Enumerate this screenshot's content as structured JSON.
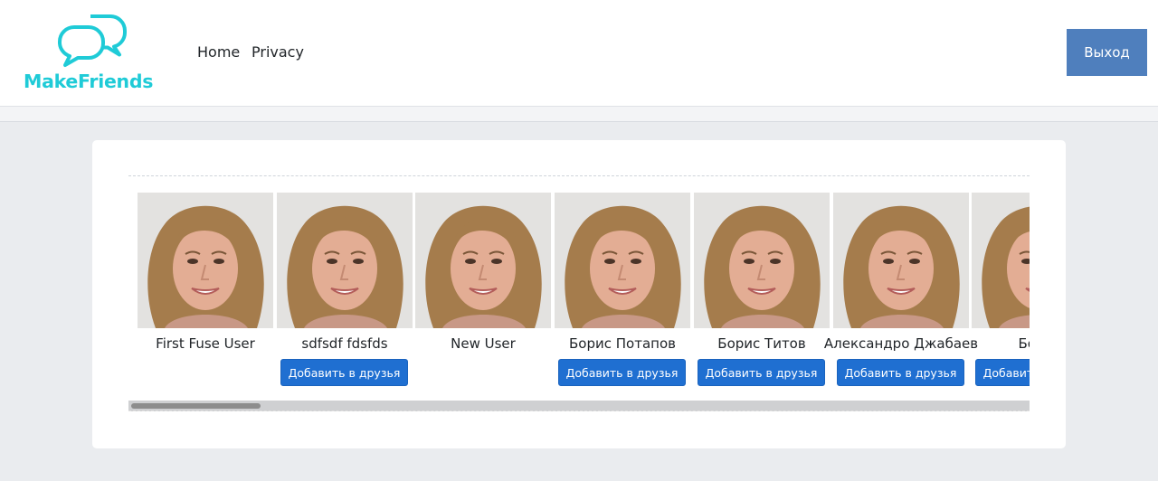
{
  "header": {
    "brand": "MakeFriends",
    "brand_color": "#1fcbd7",
    "nav": {
      "home": "Home",
      "privacy": "Privacy"
    },
    "logout_label": "Выход"
  },
  "users": [
    {
      "name": "First Fuse User",
      "button": ""
    },
    {
      "name": "sdfsdf fdsfds",
      "button": "Добавить в друзья"
    },
    {
      "name": "New User",
      "button": ""
    },
    {
      "name": "Борис Потапов",
      "button": "Добавить в друзья"
    },
    {
      "name": "Борис Титов",
      "button": "Добавить в друзья"
    },
    {
      "name": "Александро Джабаев",
      "button": "Добавить в друзья"
    },
    {
      "name": "Борис",
      "button": "Добавить в друзья"
    }
  ],
  "colors": {
    "accent": "#1f6fd1",
    "logout": "#4f7fbd",
    "background": "#eaecef"
  }
}
